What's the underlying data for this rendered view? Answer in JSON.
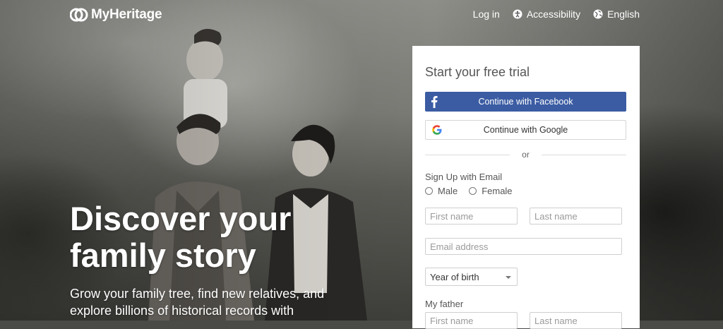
{
  "brand": {
    "name": "MyHeritage"
  },
  "nav": {
    "login": "Log in",
    "accessibility": "Accessibility",
    "language": "English"
  },
  "hero": {
    "headline": "Discover your family story",
    "subhead": "Grow your family tree, find new relatives, and explore billions of historical records with"
  },
  "signup": {
    "title": "Start your free trial",
    "facebook_button": "Continue with Facebook",
    "google_button": "Continue with Google",
    "divider": "or",
    "email_section": "Sign Up with Email",
    "gender": {
      "male": "Male",
      "female": "Female"
    },
    "first_name_placeholder": "First name",
    "last_name_placeholder": "Last name",
    "email_placeholder": "Email address",
    "year_of_birth": "Year of birth",
    "father_label": "My father",
    "father_first_placeholder": "First name",
    "father_last_placeholder": "Last name"
  },
  "colors": {
    "facebook": "#3b5ca3",
    "panel_bg": "#ffffff"
  }
}
